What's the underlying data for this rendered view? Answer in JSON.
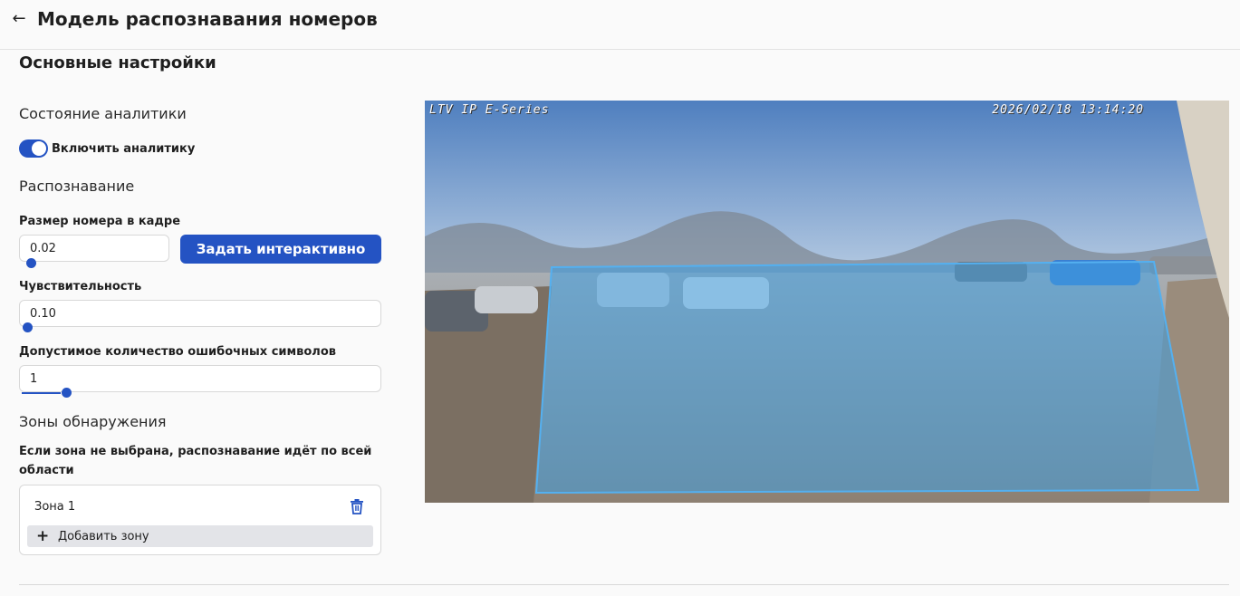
{
  "header": {
    "title": "Модель распознавания номеров",
    "back_icon": "arrow-left-icon"
  },
  "section_title": "Основные настройки",
  "analytics": {
    "group_title": "Состояние аналитики",
    "toggle_label": "Включить аналитику",
    "enabled": true
  },
  "recognition": {
    "group_title": "Распознавание",
    "plate_size": {
      "label": "Размер номера в кадре",
      "value": "0.02"
    },
    "set_interactive_button": "Задать интерактивно",
    "sensitivity": {
      "label": "Чувствительность",
      "value": "0.10"
    },
    "error_chars": {
      "label": "Допустимое количество ошибочных символов",
      "value": "1"
    }
  },
  "zones": {
    "group_title": "Зоны обнаружения",
    "note": "Если зона не выбрана, распознавание идёт по всей области",
    "items": [
      {
        "name": "Зона 1",
        "delete_icon": "trash-icon"
      }
    ],
    "add_label": "Добавить зону",
    "add_icon": "plus-icon"
  },
  "camera": {
    "osd_left": "LTV IP E-Series",
    "osd_right": "2026/02/18 13:14:20"
  },
  "colors": {
    "accent": "#2453c3",
    "zone_fill": "#3f9fe0"
  }
}
